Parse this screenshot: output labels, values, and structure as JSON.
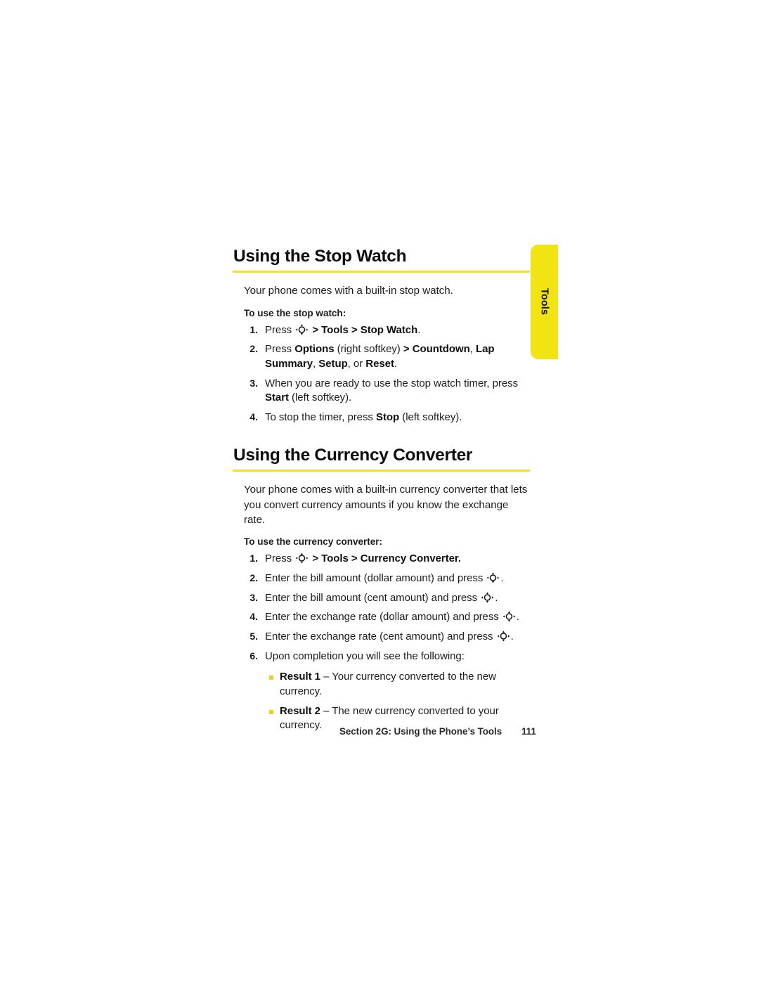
{
  "colors": {
    "tab_yellow": "#F2E312",
    "rule_yellow": "#F5E02A",
    "bullet_yellow": "#F2D018",
    "text": "#1c1c1c"
  },
  "section_tab": {
    "label": "Tools"
  },
  "sections": [
    {
      "heading": "Using the Stop Watch",
      "intro": "Your phone comes with a built-in stop watch.",
      "lead_in": "To use the stop watch:",
      "steps": [
        {
          "number": "1.",
          "parts": [
            {
              "type": "text",
              "text": "Press "
            },
            {
              "type": "icon",
              "name": "navigation-key-icon"
            },
            {
              "type": "bold",
              "text": " > Tools > Stop Watch"
            },
            {
              "type": "text",
              "text": "."
            }
          ]
        },
        {
          "number": "2.",
          "parts": [
            {
              "type": "text",
              "text": "Press "
            },
            {
              "type": "bold",
              "text": "Options"
            },
            {
              "type": "text",
              "text": " (right softkey) "
            },
            {
              "type": "bold",
              "text": "> Countdown"
            },
            {
              "type": "text",
              "text": ", "
            },
            {
              "type": "bold",
              "text": "Lap Summary"
            },
            {
              "type": "text",
              "text": ", "
            },
            {
              "type": "bold",
              "text": "Setup"
            },
            {
              "type": "text",
              "text": ", or "
            },
            {
              "type": "bold",
              "text": "Reset"
            },
            {
              "type": "text",
              "text": "."
            }
          ]
        },
        {
          "number": "3.",
          "parts": [
            {
              "type": "text",
              "text": "When you are ready to use the stop watch timer, press "
            },
            {
              "type": "bold",
              "text": "Start"
            },
            {
              "type": "text",
              "text": " (left softkey)."
            }
          ]
        },
        {
          "number": "4.",
          "parts": [
            {
              "type": "text",
              "text": "To stop the timer, press "
            },
            {
              "type": "bold",
              "text": "Stop"
            },
            {
              "type": "text",
              "text": " (left softkey)."
            }
          ]
        }
      ],
      "results": []
    },
    {
      "heading": "Using the Currency Converter",
      "intro": "Your phone comes with a built-in currency converter that lets you convert currency amounts if you know the exchange rate.",
      "lead_in": "To use the currency converter:",
      "steps": [
        {
          "number": "1.",
          "parts": [
            {
              "type": "text",
              "text": "Press "
            },
            {
              "type": "icon",
              "name": "navigation-key-icon"
            },
            {
              "type": "bold",
              "text": " > Tools > Currency Converter."
            }
          ]
        },
        {
          "number": "2.",
          "parts": [
            {
              "type": "text",
              "text": "Enter the bill amount (dollar amount) and press "
            },
            {
              "type": "icon",
              "name": "navigation-key-icon"
            },
            {
              "type": "text",
              "text": "."
            }
          ]
        },
        {
          "number": "3.",
          "parts": [
            {
              "type": "text",
              "text": "Enter the bill amount (cent amount) and press "
            },
            {
              "type": "icon",
              "name": "navigation-key-icon"
            },
            {
              "type": "text",
              "text": "."
            }
          ]
        },
        {
          "number": "4.",
          "parts": [
            {
              "type": "text",
              "text": "Enter the exchange rate (dollar amount) and press "
            },
            {
              "type": "icon",
              "name": "navigation-key-icon"
            },
            {
              "type": "text",
              "text": "."
            }
          ]
        },
        {
          "number": "5.",
          "parts": [
            {
              "type": "text",
              "text": "Enter the exchange rate (cent amount) and press "
            },
            {
              "type": "icon",
              "name": "navigation-key-icon"
            },
            {
              "type": "text",
              "text": "."
            }
          ]
        },
        {
          "number": "6.",
          "parts": [
            {
              "type": "text",
              "text": "Upon completion you will see the following:"
            }
          ]
        }
      ],
      "results": [
        {
          "parts": [
            {
              "type": "bold",
              "text": "Result 1"
            },
            {
              "type": "text",
              "text": " – Your currency converted to the new currency."
            }
          ]
        },
        {
          "parts": [
            {
              "type": "bold",
              "text": "Result 2"
            },
            {
              "type": "text",
              "text": " – The new currency converted to your currency."
            }
          ]
        }
      ]
    }
  ],
  "footer": {
    "section_label": "Section 2G: Using the Phone’s Tools",
    "page_number": "111"
  }
}
